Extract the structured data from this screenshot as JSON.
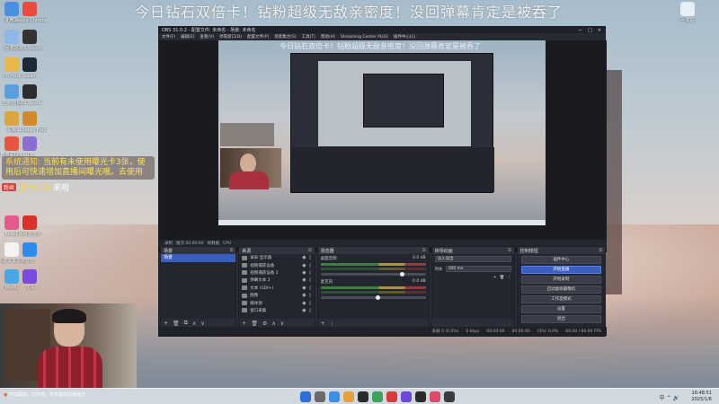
{
  "danmaku": "今日钻石双倍卡！钻粉超级无敌亲密度！没回弹幕肯定是被吞了",
  "desktop_icons": [
    {
      "label": "此电脑",
      "color": "#4a90e2"
    },
    {
      "label": "Google Chrome",
      "color": "#e94b3c"
    },
    {
      "label": "回收站",
      "color": "#8fb7e8"
    },
    {
      "label": "OBS Studio",
      "color": "#333333"
    },
    {
      "label": "UP Host",
      "color": "#e6b84a"
    },
    {
      "label": "Steam",
      "color": "#1b2838"
    },
    {
      "label": "控制面板",
      "color": "#5aa0e0"
    },
    {
      "label": "OBS Studio",
      "color": "#2e2e2e"
    },
    {
      "label": "设置",
      "color": "#d9a640"
    },
    {
      "label": "Wallpaper Engine",
      "color": "#d08a2a"
    },
    {
      "label": "奇游联机宝",
      "color": "#e8553e"
    },
    {
      "label": "LOL",
      "color": "#8a6fd0"
    },
    {
      "label": "Bilibili",
      "color": "#e55a8a"
    },
    {
      "label": "网易云音乐",
      "color": "#d9312b"
    },
    {
      "label": "新建文本文档",
      "color": "#f3f3f3"
    },
    {
      "label": "音乐",
      "color": "#2d8cf0"
    },
    {
      "label": "MuMu",
      "color": "#49a7e8"
    },
    {
      "label": "飞书",
      "color": "#7a4be0"
    }
  ],
  "desktop_right_icon": "回收站",
  "chat": {
    "system_tag": "系统通知:",
    "system_text": "当前有未使用曝光卡3张，使用后可快速增加直播间曝光哦。去使用",
    "badge": "粉丝",
    "user": "龙仔076",
    "message": "来啦"
  },
  "obs": {
    "title": "OBS 31.0.2 - 配置文件: 未命名 - 场景: 未命名",
    "menu": [
      "文件(F)",
      "编辑(E)",
      "查看(V)",
      "停靠窗口(D)",
      "配置文件(P)",
      "场景集合(S)",
      "工具(T)",
      "帮助(H)",
      "Streaming Center PLUG",
      "插件中心(C)"
    ],
    "preview_tabs": [
      "录制",
      "推流 00:00:00",
      "帧数据",
      "CPU"
    ],
    "docks": {
      "scenes": {
        "title": "场景",
        "items": [
          "场景"
        ]
      },
      "sources": {
        "title": "来源",
        "items": [
          {
            "name": "录屏·显示器",
            "visible": true,
            "locked": false
          },
          {
            "name": "视频捕获设备",
            "visible": true,
            "locked": false
          },
          {
            "name": "视频捕获设备 2",
            "visible": true,
            "locked": false
          },
          {
            "name": "弹幕文本 2",
            "visible": true,
            "locked": false
          },
          {
            "name": "文本 (GDI+)",
            "visible": true,
            "locked": false
          },
          {
            "name": "图像",
            "visible": true,
            "locked": false
          },
          {
            "name": "媒体源",
            "visible": true,
            "locked": false
          },
          {
            "name": "窗口采集",
            "visible": true,
            "locked": false
          }
        ]
      },
      "mixer": {
        "title": "混音器",
        "channels": [
          {
            "name": "桌面音频",
            "db": "0.0 dB",
            "level": 0.78
          },
          {
            "name": "麦克风",
            "db": "0.0 dB",
            "level": 0.55
          }
        ]
      },
      "transitions": {
        "title": "转场动画",
        "type": "淡入淡出",
        "duration_label": "时长",
        "duration": "300 ms"
      },
      "controls": {
        "title": "控制按钮",
        "buttons": [
          "插件中心",
          "开始直播",
          "开始录制",
          "启动虚拟摄像机",
          "工作室模式",
          "设置",
          "退出"
        ],
        "active_index": 1
      }
    },
    "status": [
      "丢帧 0 (0.0%)",
      "0 kbps",
      "00:00:00",
      "00:00:00",
      "CPU: 0.0%",
      "60.00 / 60.00 FPS"
    ]
  },
  "taskbar": {
    "time": "16:48:51",
    "date": "2025/1/6",
    "tray": "中 ⌃ 🔊",
    "notification": "今日磁贴：日升夜，今天是你的幸运日"
  },
  "pv_danmaku": "今日钻石双倍卡！钻粉超级无敌亲密度！没回弹幕肯定是被吞了"
}
